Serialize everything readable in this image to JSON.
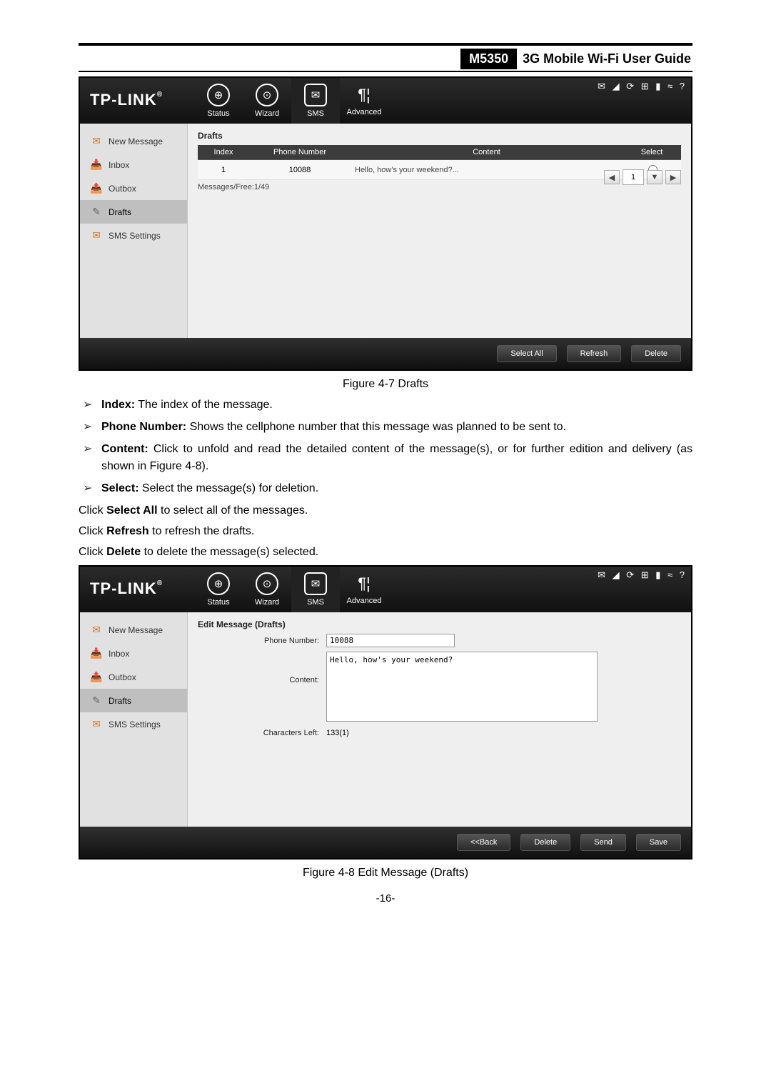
{
  "header": {
    "model": "M5350",
    "title": "3G Mobile Wi-Fi User Guide"
  },
  "logo": "TP-LINK",
  "nav": {
    "status": "Status",
    "wizard": "Wizard",
    "sms": "SMS",
    "advanced": "Advanced"
  },
  "tray": "✉  ◢  ⟳  ⊞  ▮  ≈  ?",
  "sidebar": {
    "items": [
      {
        "label": "New Message"
      },
      {
        "label": "Inbox"
      },
      {
        "label": "Outbox"
      },
      {
        "label": "Drafts"
      },
      {
        "label": "SMS Settings"
      }
    ]
  },
  "drafts": {
    "title": "Drafts",
    "headers": {
      "index": "Index",
      "phone": "Phone Number",
      "content": "Content",
      "select": "Select"
    },
    "row": {
      "index": "1",
      "phone": "10088",
      "content": "Hello, how's your weekend?..."
    },
    "meta": "Messages/Free:1/49",
    "page": "1"
  },
  "footerButtons": {
    "selectAll": "Select All",
    "refresh": "Refresh",
    "delete": "Delete"
  },
  "caption1": "Figure 4-7 Drafts",
  "bullets": [
    {
      "b": "Index:",
      "t": " The index of the message."
    },
    {
      "b": "Phone Number:",
      "t": " Shows the cellphone number that this message was planned to be sent to."
    },
    {
      "b": "Content:",
      "t": " Click to unfold and read the detailed content of the message(s), or for further edition and delivery (as shown in Figure 4-8)."
    },
    {
      "b": "Select:",
      "t": " Select the message(s) for deletion."
    }
  ],
  "p1": {
    "pre": "Click ",
    "b": "Select All",
    "post": " to select all of the messages."
  },
  "p2": {
    "pre": "Click ",
    "b": "Refresh",
    "post": " to refresh the drafts."
  },
  "p3": {
    "pre": "Click ",
    "b": "Delete",
    "post": " to delete the message(s) selected."
  },
  "edit": {
    "title": "Edit Message (Drafts)",
    "phoneLabel": "Phone Number:",
    "phoneValue": "10088",
    "contentLabel": "Content:",
    "contentValue": "Hello, how's your weekend?",
    "charsLabel": "Characters Left:",
    "charsValue": "133(1)"
  },
  "editButtons": {
    "back": "<<Back",
    "delete": "Delete",
    "send": "Send",
    "save": "Save"
  },
  "caption2": "Figure 4-8 Edit Message (Drafts)",
  "pageNum": "-16-"
}
